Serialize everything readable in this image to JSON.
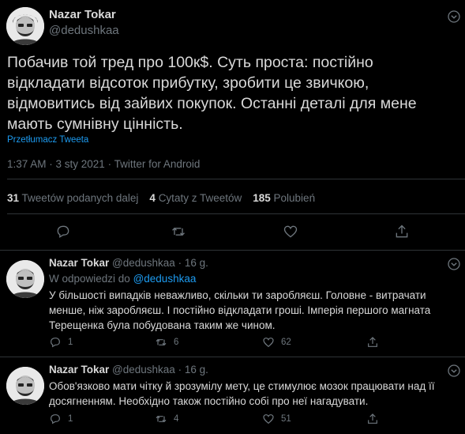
{
  "main_tweet": {
    "author_name": "Nazar Tokar",
    "handle": "@dedushkaa",
    "text": "Побачив той тред про 100к$. Суть проста: постійно відкладати відсоток прибутку, зробити це звичкою, відмовитись від зайвих покупок. Останні деталі для мене мають сумнівну цінність.",
    "translate_label": "Przetłumacz Tweeta",
    "timestamp": "1:37 AM · 3 sty 2021 · Twitter for Android",
    "retweets_count": "31",
    "retweets_label": "Tweetów podanych dalej",
    "quotes_count": "4",
    "quotes_label": "Cytaty z Tweetów",
    "likes_count": "185",
    "likes_label": "Polubień"
  },
  "replies": [
    {
      "author_name": "Nazar Tokar",
      "handle": "@dedushkaa",
      "time": "· 16 g.",
      "reply_prefix": "W odpowiedzi do",
      "reply_to": "@dedushkaa",
      "text": "У більшості випадків неважливо, скільки ти заробляєш. Головне - витрачати менше, ніж заробляєш. І постійно відкладати гроші. Імперія першого магната Терещенка була побудована таким же чином.",
      "reply_count": "1",
      "retweet_count": "6",
      "like_count": "62"
    },
    {
      "author_name": "Nazar Tokar",
      "handle": "@dedushkaa",
      "time": "· 16 g.",
      "text": "Обов'язково мати чітку й зрозумілу мету, це стимулює мозок працювати над її досягненням. Необхідно також постійно собі про неї нагадувати.",
      "reply_count": "1",
      "retweet_count": "4",
      "like_count": "51"
    }
  ],
  "colors": {
    "background": "#000000",
    "text": "#d9d9d9",
    "muted": "#6e767d",
    "link": "#1d9bf0",
    "divider": "#2f3336"
  },
  "icons": [
    "chevron-down-icon",
    "reply-icon",
    "retweet-icon",
    "like-icon",
    "share-icon",
    "avatar"
  ]
}
